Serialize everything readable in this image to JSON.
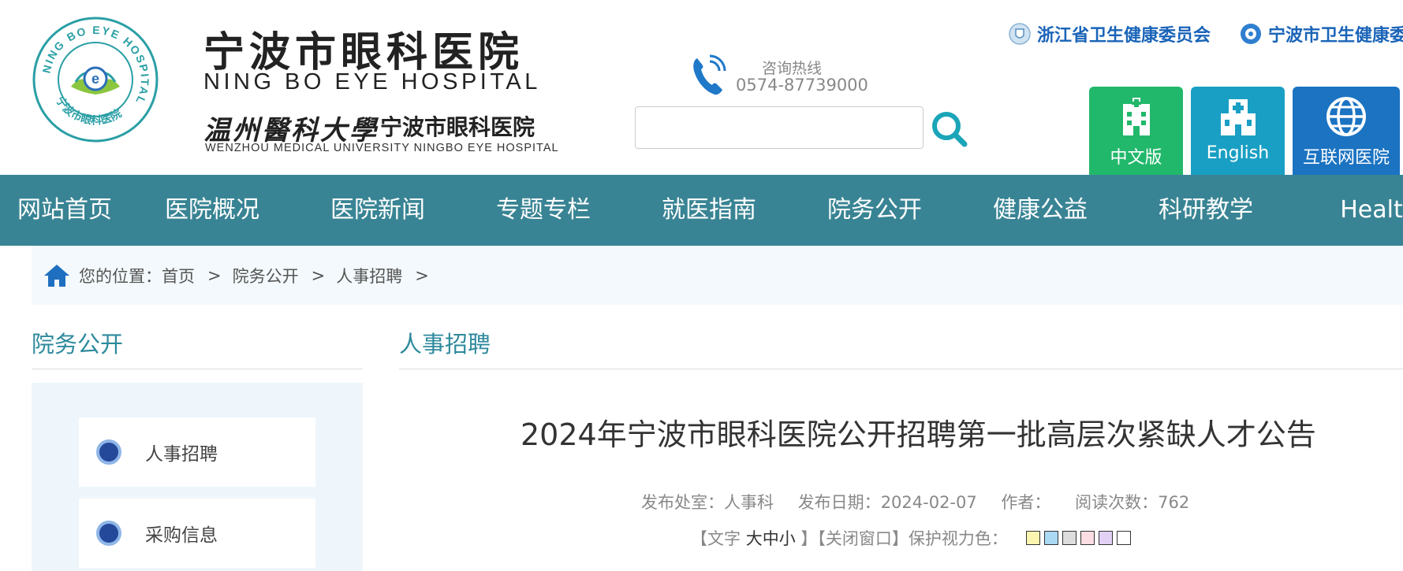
{
  "header": {
    "logo_ring_text": "NING BO EYE HOSPITAL",
    "logo_inner_text": "宁波市眼科医院",
    "hospital_name_cn": "宁波市眼科医院",
    "hospital_name_en": "NING BO EYE HOSPITAL",
    "university_cn": "温州醫科大學",
    "hospital_name_cn2": "宁波市眼科医院",
    "university_en": "WENZHOU MEDICAL UNIVERSITY  NINGBO EYE HOSPITAL",
    "hotline_label": "咨询热线",
    "hotline_number": "0574-87739000",
    "search_placeholder": "",
    "top_links": [
      "浙江省卫生健康委员会",
      "宁波市卫生健康委"
    ],
    "version_buttons": [
      "中文版",
      "English",
      "互联网医院"
    ]
  },
  "nav": [
    "网站首页",
    "医院概况",
    "医院新闻",
    "专题专栏",
    "就医指南",
    "院务公开",
    "健康公益",
    "科研教学",
    "Healt"
  ],
  "breadcrumb": {
    "label": "您的位置：",
    "items": [
      "首页",
      "院务公开",
      "人事招聘"
    ],
    "separator": ">"
  },
  "sidebar": {
    "title": "院务公开",
    "items": [
      "人事招聘",
      "采购信息"
    ]
  },
  "main": {
    "section_title": "人事招聘",
    "article_title": "2024年宁波市眼科医院公开招聘第一批高层次紧缺人才公告",
    "meta": {
      "dept_label": "发布处室：",
      "dept": "人事科",
      "date_label": "发布日期：",
      "date": "2024-02-07",
      "author_label": "作者：",
      "author": "",
      "views_label": "阅读次数：",
      "views": "762"
    },
    "tools": {
      "open_text": "【文字",
      "font_sizes": [
        "大",
        "中",
        "小"
      ],
      "mid": "】【",
      "close_window": "关闭窗口",
      "end": "】",
      "eye_protect_label": "保护视力色：",
      "colors": [
        "#fbf5b0",
        "#a9d9f3",
        "#dddddd",
        "#fbdde3",
        "#e3d1f5",
        "#ffffff"
      ]
    }
  },
  "colors": {
    "nav_bg": "#398494",
    "accent": "#2e8a9c",
    "link_blue": "#1a64b8",
    "btn_cn": "#22b86c",
    "btn_en": "#1a9fc4",
    "btn_web": "#1b73c2"
  },
  "icons": {
    "phone": "phone-icon",
    "search": "search-icon",
    "home": "home-icon",
    "emblem": "emblem-icon",
    "hospital_building": "hospital-building-icon",
    "hospital_cross": "hospital-cross-icon",
    "globe": "globe-icon"
  }
}
